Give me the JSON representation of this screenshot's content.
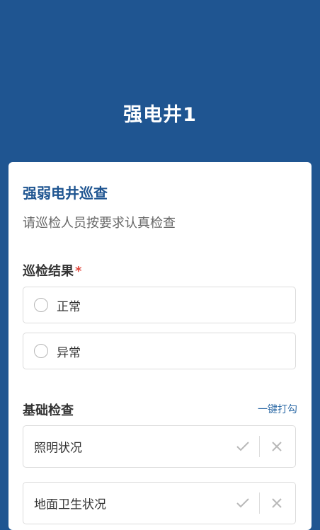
{
  "header": {
    "title": "强电井1"
  },
  "form": {
    "title": "强弱电井巡查",
    "description": "请巡检人员按要求认真检查"
  },
  "inspection_result": {
    "label": "巡检结果",
    "required_mark": "*",
    "options": [
      {
        "label": "正常"
      },
      {
        "label": "异常"
      }
    ]
  },
  "basic_check": {
    "label": "基础检查",
    "one_click_label": "一键打勾",
    "items": [
      {
        "label": "照明状况"
      },
      {
        "label": "地面卫生状况"
      }
    ]
  },
  "icons": {
    "check": "check-icon",
    "cross": "close-icon",
    "radio": "radio-unchecked-icon"
  },
  "colors": {
    "brand": "#1f5591",
    "required": "#e0463c",
    "link": "#2d6aa6"
  }
}
